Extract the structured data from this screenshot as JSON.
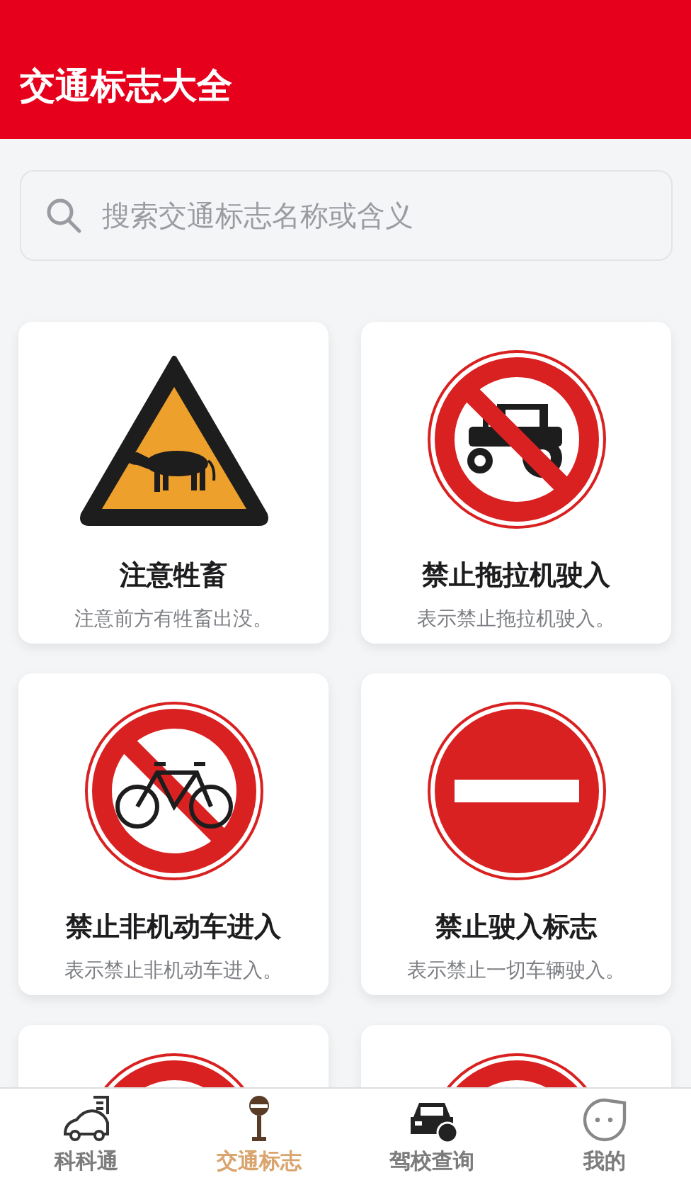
{
  "header": {
    "title": "交通标志大全"
  },
  "search": {
    "placeholder": "搜索交通标志名称或含义"
  },
  "signs": [
    {
      "kind": "warning-cattle",
      "name": "注意牲畜",
      "description": "注意前方有牲畜出没。"
    },
    {
      "kind": "no-tractor",
      "name": "禁止拖拉机驶入",
      "description": "表示禁止拖拉机驶入。"
    },
    {
      "kind": "no-bicycle",
      "name": "禁止非机动车进入",
      "description": "表示禁止非机动车进入。"
    },
    {
      "kind": "no-entry",
      "name": "禁止驶入标志",
      "description": "表示禁止一切车辆驶入。"
    },
    {
      "kind": "prohibition"
    },
    {
      "kind": "prohibition"
    }
  ],
  "tabbar": [
    {
      "kind": "car",
      "label": "科科通",
      "selected": false
    },
    {
      "kind": "sign",
      "label": "交通标志",
      "selected": true
    },
    {
      "kind": "school",
      "label": "驾校查询",
      "selected": false
    },
    {
      "kind": "face",
      "label": "我的",
      "selected": false
    }
  ]
}
